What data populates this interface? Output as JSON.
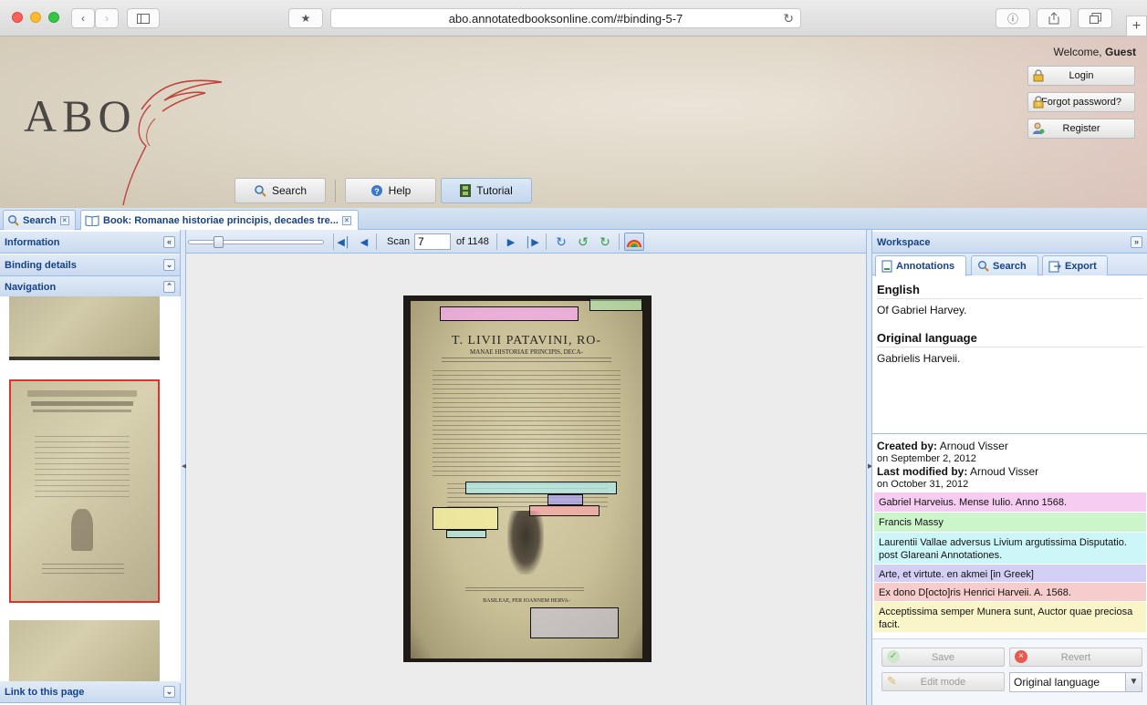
{
  "browser": {
    "url": "abo.annotatedbooksonline.com/#binding-5-7"
  },
  "header": {
    "logo": "ABO",
    "welcome_prefix": "Welcome,",
    "welcome_user": "Guest",
    "login": "Login",
    "forgot_password": "Forgot password?",
    "register": "Register",
    "nav": {
      "search": "Search",
      "help": "Help",
      "tutorial": "Tutorial"
    }
  },
  "tabs": [
    {
      "label": "Search"
    },
    {
      "label": "Book: Romanae historiae principis, decades tre..."
    }
  ],
  "left_panel": {
    "information": "Information",
    "binding_details": "Binding details",
    "navigation": "Navigation",
    "link": "Link to this page"
  },
  "viewer": {
    "scan_label": "Scan",
    "scan_value": "7",
    "of_total": "of 1148",
    "zoom_fraction": 0.2,
    "page_title_line1": "T. LIVII PATAVINI, RO-",
    "page_title_line2": "MANAE HISTORIAE PRINCIPIS, DECA-",
    "page_footer": "BASILEAE, PER IOANNEM HERVA-"
  },
  "workspace": {
    "title": "Workspace",
    "tabs": {
      "annotations": "Annotations",
      "search": "Search",
      "export": "Export"
    },
    "english_heading": "English",
    "english_text": "Of Gabriel Harvey.",
    "original_heading": "Original language",
    "original_text": "Gabrielis Harveii.",
    "created_label": "Created by:",
    "created_by": "Arnoud Visser",
    "created_on": "on September 2, 2012",
    "modified_label": "Last modified by:",
    "modified_by": "Arnoud Visser",
    "modified_on": "on October 31, 2012",
    "annotations": [
      {
        "text": "Gabriel Harveius. Mense Iulio. Anno 1568.",
        "color": "#f6ccf2"
      },
      {
        "text": "Francis Massy",
        "color": "#ccf5cc"
      },
      {
        "text": "Laurentii Vallae adversus Livium argutissima Disputatio. post Glareani Annotationes.",
        "color": "#ccf6f8"
      },
      {
        "text": "Arte, et virtute. en akmei [in Greek]",
        "color": "#d4d0f5"
      },
      {
        "text": "Ex dono D[octo]ris Henrici Harveii. A. 1568.",
        "color": "#f7cccc"
      },
      {
        "text": "Acceptissima semper Munera sunt, Auctor quae preciosa facit.",
        "color": "#f9f5c8"
      }
    ],
    "save": "Save",
    "revert": "Revert",
    "edit_mode": "Edit mode",
    "language_select": "Original language"
  }
}
